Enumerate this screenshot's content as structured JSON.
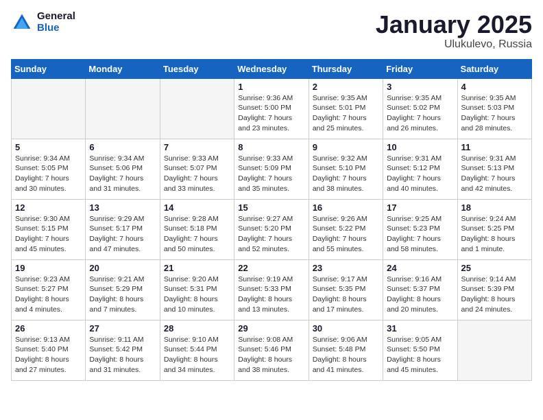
{
  "logo": {
    "general": "General",
    "blue": "Blue"
  },
  "header": {
    "month": "January 2025",
    "location": "Ulukulevo, Russia"
  },
  "weekdays": [
    "Sunday",
    "Monday",
    "Tuesday",
    "Wednesday",
    "Thursday",
    "Friday",
    "Saturday"
  ],
  "weeks": [
    [
      {
        "day": "",
        "info": ""
      },
      {
        "day": "",
        "info": ""
      },
      {
        "day": "",
        "info": ""
      },
      {
        "day": "1",
        "info": "Sunrise: 9:36 AM\nSunset: 5:00 PM\nDaylight: 7 hours\nand 23 minutes."
      },
      {
        "day": "2",
        "info": "Sunrise: 9:35 AM\nSunset: 5:01 PM\nDaylight: 7 hours\nand 25 minutes."
      },
      {
        "day": "3",
        "info": "Sunrise: 9:35 AM\nSunset: 5:02 PM\nDaylight: 7 hours\nand 26 minutes."
      },
      {
        "day": "4",
        "info": "Sunrise: 9:35 AM\nSunset: 5:03 PM\nDaylight: 7 hours\nand 28 minutes."
      }
    ],
    [
      {
        "day": "5",
        "info": "Sunrise: 9:34 AM\nSunset: 5:05 PM\nDaylight: 7 hours\nand 30 minutes."
      },
      {
        "day": "6",
        "info": "Sunrise: 9:34 AM\nSunset: 5:06 PM\nDaylight: 7 hours\nand 31 minutes."
      },
      {
        "day": "7",
        "info": "Sunrise: 9:33 AM\nSunset: 5:07 PM\nDaylight: 7 hours\nand 33 minutes."
      },
      {
        "day": "8",
        "info": "Sunrise: 9:33 AM\nSunset: 5:09 PM\nDaylight: 7 hours\nand 35 minutes."
      },
      {
        "day": "9",
        "info": "Sunrise: 9:32 AM\nSunset: 5:10 PM\nDaylight: 7 hours\nand 38 minutes."
      },
      {
        "day": "10",
        "info": "Sunrise: 9:31 AM\nSunset: 5:12 PM\nDaylight: 7 hours\nand 40 minutes."
      },
      {
        "day": "11",
        "info": "Sunrise: 9:31 AM\nSunset: 5:13 PM\nDaylight: 7 hours\nand 42 minutes."
      }
    ],
    [
      {
        "day": "12",
        "info": "Sunrise: 9:30 AM\nSunset: 5:15 PM\nDaylight: 7 hours\nand 45 minutes."
      },
      {
        "day": "13",
        "info": "Sunrise: 9:29 AM\nSunset: 5:17 PM\nDaylight: 7 hours\nand 47 minutes."
      },
      {
        "day": "14",
        "info": "Sunrise: 9:28 AM\nSunset: 5:18 PM\nDaylight: 7 hours\nand 50 minutes."
      },
      {
        "day": "15",
        "info": "Sunrise: 9:27 AM\nSunset: 5:20 PM\nDaylight: 7 hours\nand 52 minutes."
      },
      {
        "day": "16",
        "info": "Sunrise: 9:26 AM\nSunset: 5:22 PM\nDaylight: 7 hours\nand 55 minutes."
      },
      {
        "day": "17",
        "info": "Sunrise: 9:25 AM\nSunset: 5:23 PM\nDaylight: 7 hours\nand 58 minutes."
      },
      {
        "day": "18",
        "info": "Sunrise: 9:24 AM\nSunset: 5:25 PM\nDaylight: 8 hours\nand 1 minute."
      }
    ],
    [
      {
        "day": "19",
        "info": "Sunrise: 9:23 AM\nSunset: 5:27 PM\nDaylight: 8 hours\nand 4 minutes."
      },
      {
        "day": "20",
        "info": "Sunrise: 9:21 AM\nSunset: 5:29 PM\nDaylight: 8 hours\nand 7 minutes."
      },
      {
        "day": "21",
        "info": "Sunrise: 9:20 AM\nSunset: 5:31 PM\nDaylight: 8 hours\nand 10 minutes."
      },
      {
        "day": "22",
        "info": "Sunrise: 9:19 AM\nSunset: 5:33 PM\nDaylight: 8 hours\nand 13 minutes."
      },
      {
        "day": "23",
        "info": "Sunrise: 9:17 AM\nSunset: 5:35 PM\nDaylight: 8 hours\nand 17 minutes."
      },
      {
        "day": "24",
        "info": "Sunrise: 9:16 AM\nSunset: 5:37 PM\nDaylight: 8 hours\nand 20 minutes."
      },
      {
        "day": "25",
        "info": "Sunrise: 9:14 AM\nSunset: 5:39 PM\nDaylight: 8 hours\nand 24 minutes."
      }
    ],
    [
      {
        "day": "26",
        "info": "Sunrise: 9:13 AM\nSunset: 5:40 PM\nDaylight: 8 hours\nand 27 minutes."
      },
      {
        "day": "27",
        "info": "Sunrise: 9:11 AM\nSunset: 5:42 PM\nDaylight: 8 hours\nand 31 minutes."
      },
      {
        "day": "28",
        "info": "Sunrise: 9:10 AM\nSunset: 5:44 PM\nDaylight: 8 hours\nand 34 minutes."
      },
      {
        "day": "29",
        "info": "Sunrise: 9:08 AM\nSunset: 5:46 PM\nDaylight: 8 hours\nand 38 minutes."
      },
      {
        "day": "30",
        "info": "Sunrise: 9:06 AM\nSunset: 5:48 PM\nDaylight: 8 hours\nand 41 minutes."
      },
      {
        "day": "31",
        "info": "Sunrise: 9:05 AM\nSunset: 5:50 PM\nDaylight: 8 hours\nand 45 minutes."
      },
      {
        "day": "",
        "info": ""
      }
    ]
  ]
}
